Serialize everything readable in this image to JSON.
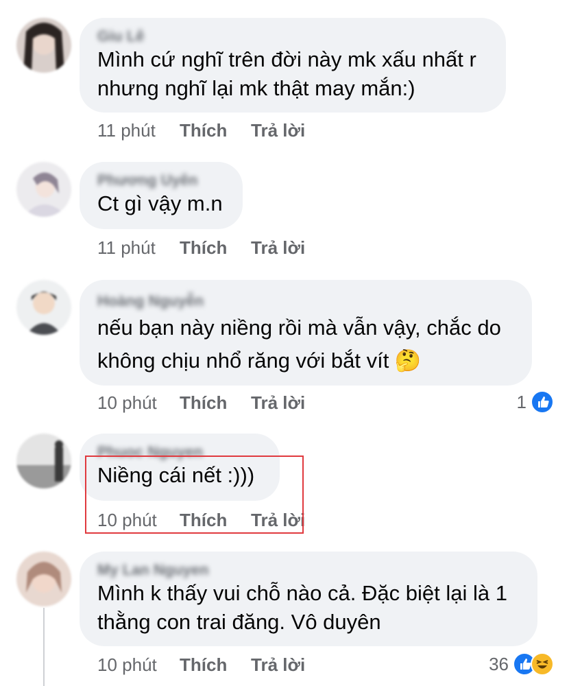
{
  "comments": [
    {
      "author": "Giu Lê",
      "lines": [
        "Mình cứ nghĩ trên đời này mk xấu nhất r",
        "nhưng nghĩ lại mk thật may mắn:)"
      ],
      "time": "11 phút",
      "like_label": "Thích",
      "reply_label": "Trả lời",
      "reaction_count": ""
    },
    {
      "author": "Phương Uyên",
      "lines": [
        "Ct gì vậy m.n"
      ],
      "time": "11 phút",
      "like_label": "Thích",
      "reply_label": "Trả lời",
      "reaction_count": ""
    },
    {
      "author": "Hoàng Nguyễn",
      "lines": [
        "nếu bạn này niềng rồi mà vẫn vậy, chắc do",
        "không chịu nhổ răng với bắt vít 🤔"
      ],
      "time": "10 phút",
      "like_label": "Thích",
      "reply_label": "Trả lời",
      "reaction_count": "1"
    },
    {
      "author": "Phuoc Nguyen",
      "lines": [
        "Niềng cái nết :)))"
      ],
      "time": "10 phút",
      "like_label": "Thích",
      "reply_label": "Trả lời",
      "reaction_count": ""
    },
    {
      "author": "My Lan Nguyen",
      "lines": [
        "Mình k thấy vui chỗ nào cả. Đặc biệt lại là 1",
        "thằng con trai đăng. Vô duyên"
      ],
      "time": "10 phút",
      "like_label": "Thích",
      "reply_label": "Trả lời",
      "reaction_count": "36"
    }
  ],
  "icons": {
    "like_reaction": "like-icon",
    "haha_reaction": "haha-icon",
    "thinking_emoji": "thinking-face-emoji"
  },
  "colors": {
    "bubble": "#f0f2f5",
    "meta_text": "#65676b",
    "like_blue": "#1877f2",
    "haha_yellow": "#f7b928",
    "highlight_red": "#e0393e"
  }
}
